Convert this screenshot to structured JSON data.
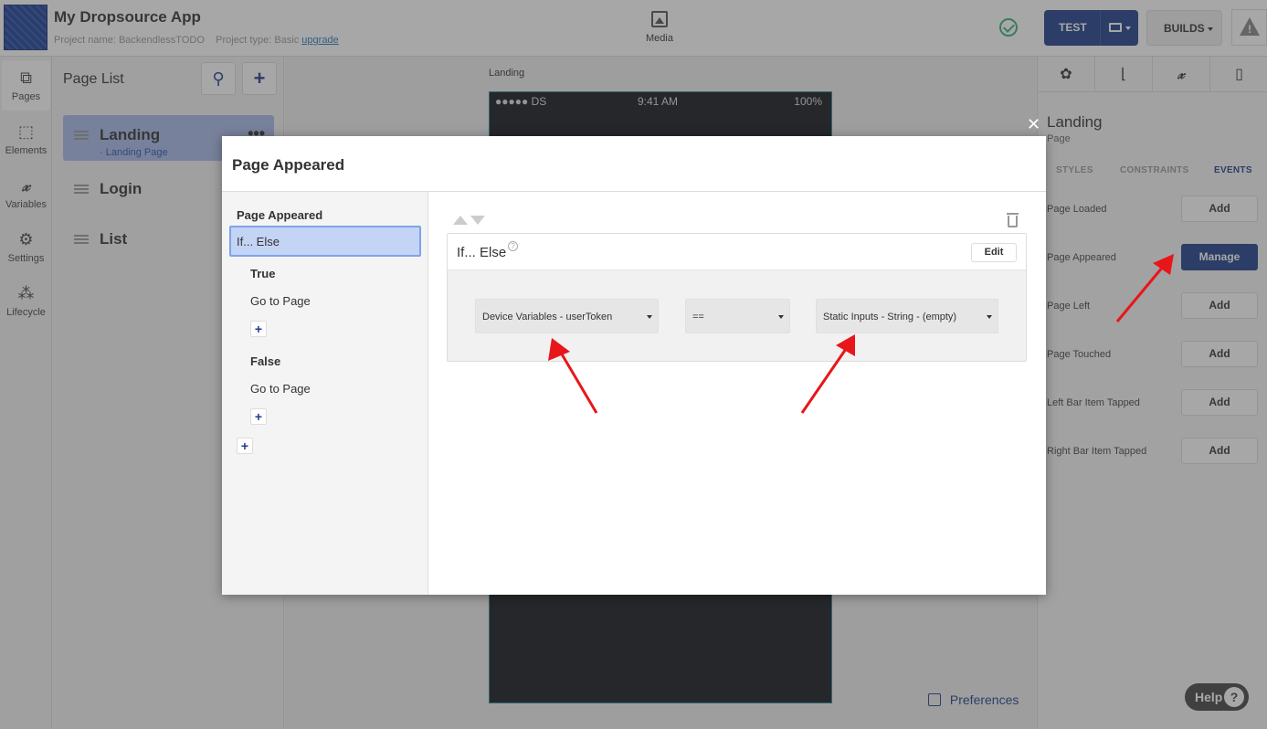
{
  "app": {
    "title": "My Dropsource App",
    "project_name_label": "Project name:",
    "project_name": "BackendlessTODO",
    "project_type_label": "Project type:",
    "project_type": "Basic",
    "upgrade_label": "upgrade"
  },
  "toolbar": {
    "media_label": "Media",
    "test_label": "TEST",
    "builds_label": "BUILDS"
  },
  "rail": {
    "items": [
      {
        "label": "Pages",
        "icon": "pages-icon"
      },
      {
        "label": "Elements",
        "icon": "elements-icon"
      },
      {
        "label": "Variables",
        "icon": "variables-icon"
      },
      {
        "label": "Settings",
        "icon": "settings-icon"
      },
      {
        "label": "Lifecycle",
        "icon": "lifecycle-icon"
      }
    ]
  },
  "page_list": {
    "title": "Page List",
    "pages": [
      {
        "name": "Landing",
        "sub": "· Landing Page"
      },
      {
        "name": "Login"
      },
      {
        "name": "List"
      }
    ]
  },
  "canvas": {
    "label": "Landing",
    "status_carrier": "●●●●● DS",
    "status_time": "9:41 AM",
    "status_battery": "100%",
    "preferences_label": "Preferences"
  },
  "right_panel": {
    "page_title": "Landing",
    "page_sub": "Page",
    "tabs": [
      "STYLES",
      "CONSTRAINTS",
      "EVENTS"
    ],
    "events": [
      {
        "label": "Page Loaded",
        "button": "Add"
      },
      {
        "label": "Page Appeared",
        "button": "Manage"
      },
      {
        "label": "Page Left",
        "button": "Add"
      },
      {
        "label": "Page Touched",
        "button": "Add"
      },
      {
        "label": "Left Bar Item Tapped",
        "button": "Add"
      },
      {
        "label": "Right Bar Item Tapped",
        "button": "Add"
      }
    ],
    "help_label": "Help"
  },
  "modal": {
    "title": "Page Appeared",
    "side": {
      "heading": "Page Appeared",
      "selected": "If... Else",
      "true_label": "True",
      "true_action": "Go to Page",
      "false_label": "False",
      "false_action": "Go to Page"
    },
    "block": {
      "title": "If... Else",
      "edit_label": "Edit",
      "left_operand": "Device Variables - userToken",
      "operator": "==",
      "right_operand": "Static Inputs - String - (empty)"
    }
  },
  "colors": {
    "accent": "#1f3f8a",
    "annotation_arrow": "#e8161a"
  }
}
